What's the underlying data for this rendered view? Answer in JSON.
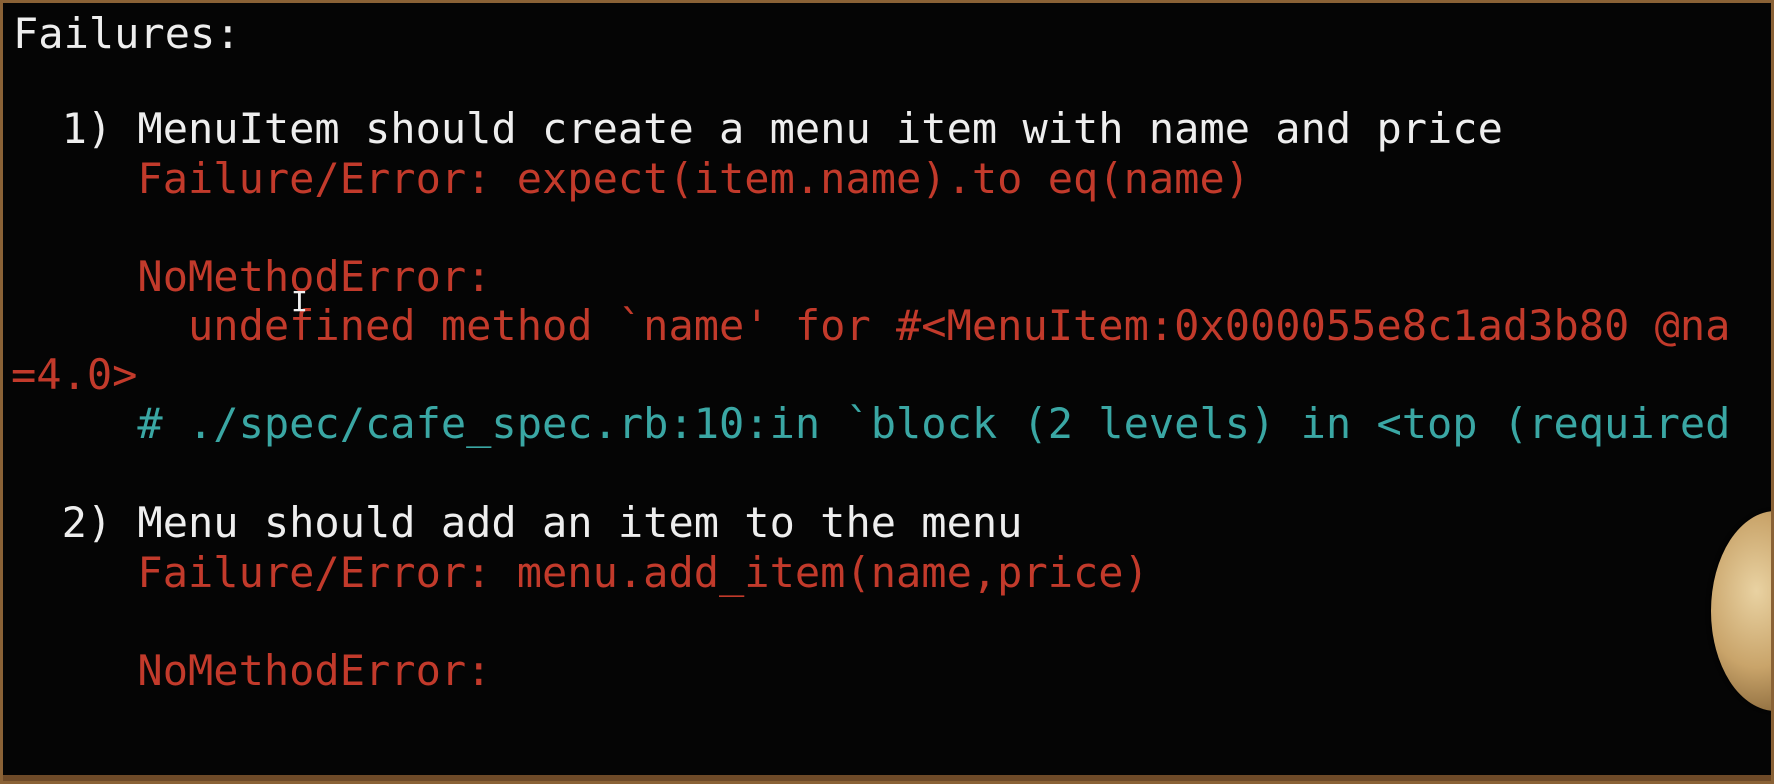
{
  "terminal": {
    "heading": "Failures:",
    "failures": [
      {
        "title": "  1) MenuItem should create a menu item with name and price",
        "failure_line": "     Failure/Error: expect(item.name).to eq(name)",
        "error_class": "     NoMethodError:",
        "error_message": "       undefined method `name' for #<MenuItem:0x000055e8c1ad3b80 @na",
        "error_message_wrap": "=4.0>",
        "backtrace": "     # ./spec/cafe_spec.rb:10:in `block (2 levels) in <top (required"
      },
      {
        "title": "  2) Menu should add an item to the menu",
        "failure_line": "     Failure/Error: menu.add_item(name,price)",
        "error_class": "     NoMethodError:"
      }
    ]
  },
  "colors": {
    "background": "#050505",
    "frame": "#8a6236",
    "text": "#eeeeee",
    "error": "#c23a2b",
    "backtrace": "#3aa7a4"
  },
  "cursor": {
    "icon": "text-cursor-icon",
    "glyph": "I"
  }
}
